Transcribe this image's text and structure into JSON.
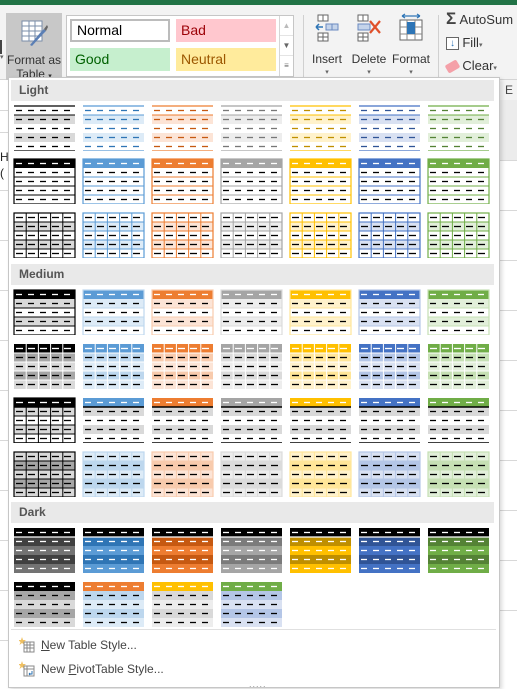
{
  "ribbon": {
    "format_as_table": {
      "line1": "Format as",
      "line2": "Table",
      "arrow": "▾",
      "icon": "format-as-table-icon"
    },
    "cell_styles": [
      {
        "name": "Normal",
        "fill": "#ffffff",
        "color": "#000000"
      },
      {
        "name": "Bad",
        "fill": "#ffc7ce",
        "color": "#9c0006"
      },
      {
        "name": "Good",
        "fill": "#c6efce",
        "color": "#006100"
      },
      {
        "name": "Neutral",
        "fill": "#ffeb9c",
        "color": "#9c5700"
      }
    ],
    "cells_group": [
      {
        "label": "Insert",
        "icon": "insert-cells-icon"
      },
      {
        "label": "Delete",
        "icon": "delete-cells-icon"
      },
      {
        "label": "Format",
        "icon": "format-cells-icon"
      }
    ],
    "editing": [
      {
        "label": "AutoSum",
        "icon": "sigma-icon",
        "has_arrow": false
      },
      {
        "label": "Fill",
        "icon": "fill-down-icon",
        "has_arrow": true
      },
      {
        "label": "Clear",
        "icon": "eraser-icon",
        "has_arrow": true
      }
    ],
    "left_cut_arrow": "▾",
    "right_cut_letter": "E"
  },
  "background": {
    "left_text_1": "H",
    "left_text_2": "("
  },
  "gallery": {
    "sections": [
      {
        "title": "Light",
        "rows": [
          [
            "light-band-none",
            "light-band",
            "light-band",
            "light-band",
            "light-band",
            "light-band",
            "light-band"
          ],
          [
            "light-header",
            "light-header",
            "light-header",
            "light-header",
            "light-header",
            "light-header",
            "light-header"
          ],
          [
            "light-grid",
            "light-grid",
            "light-grid",
            "light-grid",
            "light-grid",
            "light-grid",
            "light-grid"
          ]
        ]
      },
      {
        "title": "Medium",
        "rows": [
          [
            "med-1",
            "med-1",
            "med-1",
            "med-1",
            "med-1",
            "med-1",
            "med-1"
          ],
          [
            "med-2",
            "med-2",
            "med-2",
            "med-2",
            "med-2",
            "med-2",
            "med-2"
          ],
          [
            "med-3",
            "med-3",
            "med-3",
            "med-3",
            "med-3",
            "med-3",
            "med-3"
          ],
          [
            "med-4",
            "med-4",
            "med-4",
            "med-4",
            "med-4",
            "med-4",
            "med-4"
          ]
        ]
      },
      {
        "title": "Dark",
        "rows": [
          [
            "dark-1",
            "dark-1",
            "dark-1",
            "dark-1",
            "dark-1",
            "dark-1",
            "dark-1"
          ],
          [
            "dark-2",
            "dark-2",
            "dark-2",
            "dark-2"
          ]
        ]
      }
    ],
    "palette": [
      {
        "name": "Black",
        "main": "#000000",
        "light": "#d9d9d9",
        "mid": "#a6a6a6",
        "dark": "#404040",
        "alt": "#7f7f7f"
      },
      {
        "name": "Blue",
        "main": "#5b9bd5",
        "light": "#ddebf7",
        "mid": "#bdd7ee",
        "dark": "#2f75b5",
        "alt": "#5b9bd5"
      },
      {
        "name": "Orange",
        "main": "#ed7d31",
        "light": "#fce4d6",
        "mid": "#f8cbad",
        "dark": "#c65911",
        "alt": "#ed7d31"
      },
      {
        "name": "Gray",
        "main": "#a5a5a5",
        "light": "#ededed",
        "mid": "#dbdbdb",
        "dark": "#7b7b7b",
        "alt": "#a5a5a5"
      },
      {
        "name": "Gold",
        "main": "#ffc000",
        "light": "#fff2cc",
        "mid": "#ffe699",
        "dark": "#bf8f00",
        "alt": "#ffc000"
      },
      {
        "name": "DarkBlue",
        "main": "#4472c4",
        "light": "#d9e1f2",
        "mid": "#b4c6e7",
        "dark": "#305496",
        "alt": "#4472c4"
      },
      {
        "name": "Green",
        "main": "#70ad47",
        "light": "#e2efda",
        "mid": "#c6e0b4",
        "dark": "#548235",
        "alt": "#70ad47"
      }
    ],
    "dark2_headers": [
      "#000000",
      "#ed7d31",
      "#ffc000",
      "#70ad47"
    ],
    "dark2_bands": [
      "#a6a6a6",
      "#bdd7ee",
      "#d9d9d9",
      "#b4c6e7"
    ],
    "menu": [
      {
        "prefix": "",
        "ul": "N",
        "rest": "ew Table Style...",
        "icon": "new-table-style-icon"
      },
      {
        "prefix": "New ",
        "ul": "P",
        "rest": "ivotTable Style...",
        "icon": "new-pivottable-style-icon"
      }
    ],
    "resize_grip": "....."
  }
}
